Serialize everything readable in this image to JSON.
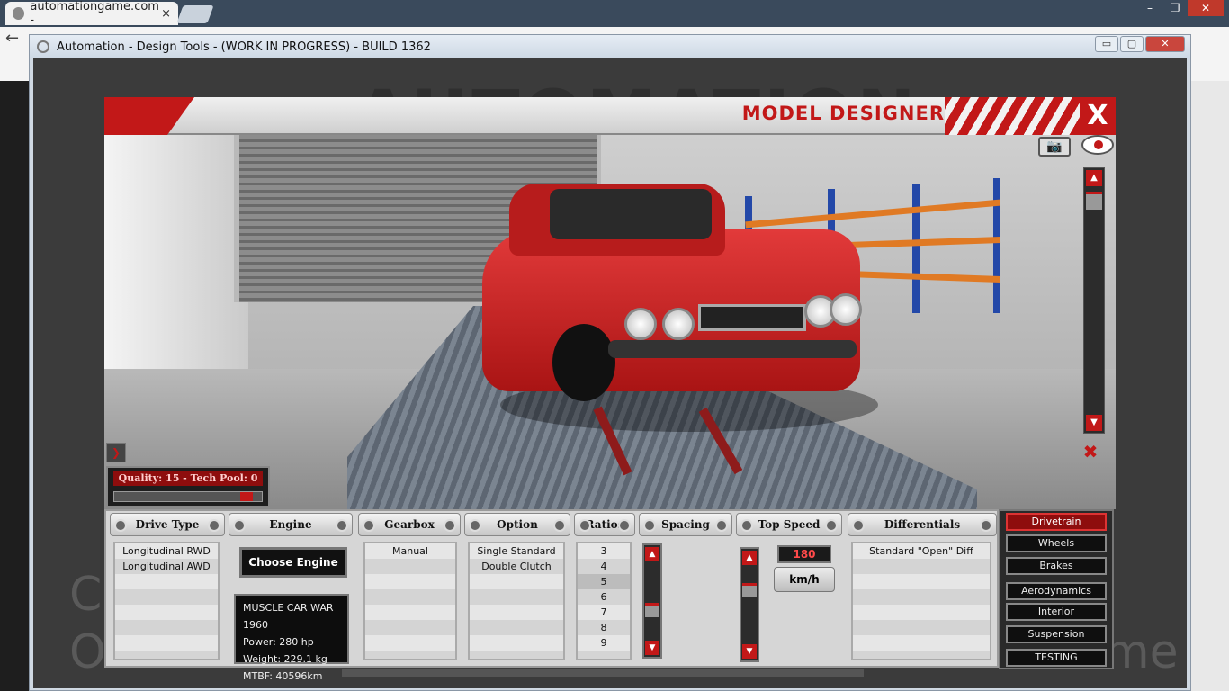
{
  "browser": {
    "tab_title": "automationgame.com -",
    "tab_close": "×",
    "win_min": "–",
    "win_max": "❐",
    "win_close": "✕",
    "back": "←"
  },
  "app": {
    "title": "Automation - Design Tools - (WORK IN PROGRESS) - BUILD 1362",
    "min": "▭",
    "max": "▢",
    "close": "✕"
  },
  "background_words": [
    "C",
    "O",
    "me"
  ],
  "designer": {
    "title": "MODEL DESIGNER",
    "close": "X",
    "expand": "❯",
    "quality_text": "Quality: 15 - Tech Pool: 0"
  },
  "columns": {
    "drive_type": {
      "header": "Drive Type",
      "options": [
        "Longitudinal RWD",
        "Longitudinal AWD"
      ]
    },
    "engine": {
      "header": "Engine",
      "choose": "Choose Engine",
      "info": [
        "MUSCLE CAR WAR 1960",
        "Power: 280 hp",
        "Weight: 229.1 kg",
        "MTBF: 40596km"
      ]
    },
    "gearbox": {
      "header": "Gearbox",
      "options": [
        "Manual"
      ]
    },
    "option": {
      "header": "Option",
      "options": [
        "Single Standard",
        "Double Clutch"
      ]
    },
    "ratios": {
      "header": "Ratios",
      "options": [
        "3",
        "4",
        "5",
        "6",
        "7",
        "8",
        "9"
      ],
      "selected": "5"
    },
    "spacing": {
      "header": "Spacing"
    },
    "top_speed": {
      "header": "Top Speed",
      "value": "180",
      "unit": "km/h"
    },
    "differentials": {
      "header": "Differentials",
      "options": [
        "Standard \"Open\" Diff"
      ]
    }
  },
  "side_menu": {
    "items": [
      "Drivetrain",
      "Wheels",
      "Brakes",
      "Aerodynamics",
      "Interior",
      "Suspension",
      "TESTING"
    ],
    "active": "Drivetrain"
  },
  "scroll_up": "▲",
  "scroll_down": "▼",
  "colors": {
    "accent_red": "#c21818",
    "panel_grey": "#d6d6d6"
  }
}
